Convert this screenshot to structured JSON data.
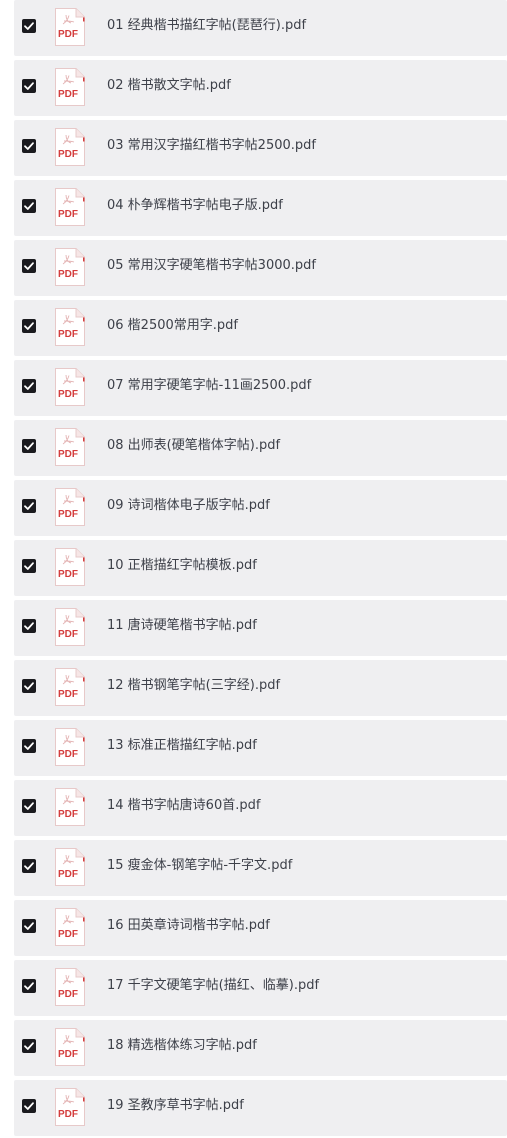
{
  "file_list": {
    "icon": "pdf-file-icon",
    "check_state": "checked",
    "colors": {
      "row_background": "#efeff1",
      "checkbox": "#1b1b1f",
      "pdf_accent": "#d43d3d",
      "text": "#3d4049"
    },
    "items": [
      {
        "name": "01 经典楷书描红字帖(琵琶行).pdf"
      },
      {
        "name": "02 楷书散文字帖.pdf"
      },
      {
        "name": "03 常用汉字描红楷书字帖2500.pdf"
      },
      {
        "name": "04 朴争辉楷书字帖电子版.pdf"
      },
      {
        "name": "05 常用汉字硬笔楷书字帖3000.pdf"
      },
      {
        "name": "06 楷2500常用字.pdf"
      },
      {
        "name": "07 常用字硬笔字帖-11画2500.pdf"
      },
      {
        "name": "08 出师表(硬笔楷体字帖).pdf"
      },
      {
        "name": "09 诗词楷体电子版字帖.pdf"
      },
      {
        "name": "10 正楷描红字帖模板.pdf"
      },
      {
        "name": "11 唐诗硬笔楷书字帖.pdf"
      },
      {
        "name": "12 楷书钢笔字帖(三字经).pdf"
      },
      {
        "name": "13 标准正楷描红字帖.pdf"
      },
      {
        "name": "14 楷书字帖唐诗60首.pdf"
      },
      {
        "name": "15 瘦金体-钢笔字帖-千字文.pdf"
      },
      {
        "name": "16 田英章诗词楷书字帖.pdf"
      },
      {
        "name": "17 千字文硬笔字帖(描红、临摹).pdf"
      },
      {
        "name": "18 精选楷体练习字帖.pdf"
      },
      {
        "name": "19 圣教序草书字帖.pdf"
      }
    ]
  }
}
